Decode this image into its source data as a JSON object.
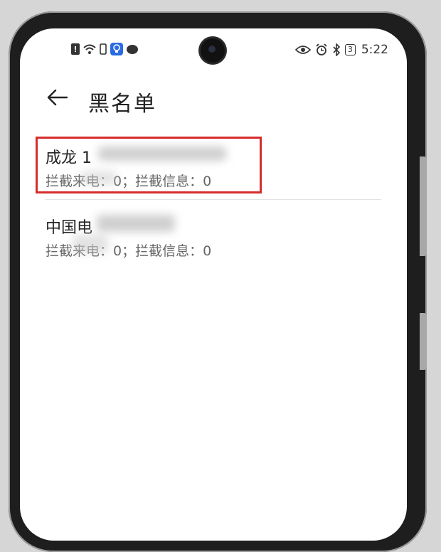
{
  "status_bar": {
    "icons_left": [
      "alert-icon",
      "wifi-icon",
      "sim-icon",
      "lightbulb-app-icon",
      "chat-bubble-icon"
    ],
    "icons_right": [
      "eye-icon",
      "alarm-icon",
      "bluetooth-icon",
      "battery-icon"
    ],
    "battery_level": "3",
    "time": "5:22",
    "alert_glyph": "!"
  },
  "header": {
    "back_glyph": "←",
    "title": "黑名单"
  },
  "blacklist": [
    {
      "name": "成龙 1",
      "detail": "拦截来电：0；拦截信息：0"
    },
    {
      "name": "中国电",
      "detail": "拦截来电：0；拦截信息：0"
    }
  ],
  "colors": {
    "highlight": "#d62c2c",
    "accent_blue": "#2a6be0"
  }
}
